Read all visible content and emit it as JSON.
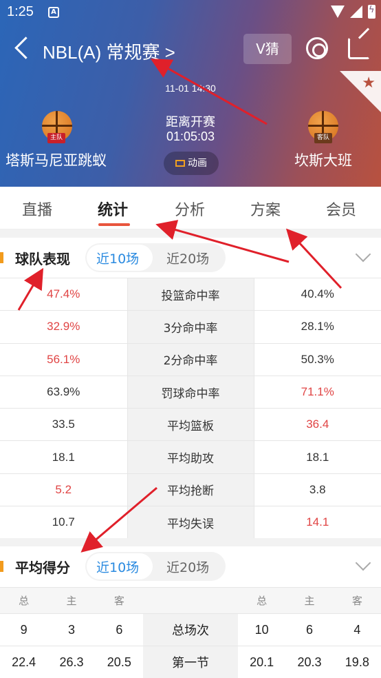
{
  "status": {
    "time": "1:25",
    "a_icon": "A"
  },
  "header": {
    "league": "NBL(A) 常规赛 >",
    "vguess": "V猜",
    "match_time": "11-01 14:30",
    "countdown_label": "距离开赛",
    "countdown": "01:05:03",
    "animation_label": "动画",
    "home": {
      "name": "塔斯马尼亚跳蚁",
      "badge": "主队",
      "badge_color": "#c8202a"
    },
    "away": {
      "name": "坎斯大班",
      "badge": "客队",
      "badge_color": "#6b3a1c"
    }
  },
  "tabs": [
    "直播",
    "统计",
    "分析",
    "方案",
    "会员"
  ],
  "team_perf": {
    "title": "球队表现",
    "opt1": "近10场",
    "opt2": "近20场",
    "rows": [
      {
        "home": "47.4%",
        "label": "投篮命中率",
        "away": "40.4%",
        "hi": "home"
      },
      {
        "home": "32.9%",
        "label": "3分命中率",
        "away": "28.1%",
        "hi": "home"
      },
      {
        "home": "56.1%",
        "label": "2分命中率",
        "away": "50.3%",
        "hi": "home"
      },
      {
        "home": "63.9%",
        "label": "罚球命中率",
        "away": "71.1%",
        "hi": "away"
      },
      {
        "home": "33.5",
        "label": "平均篮板",
        "away": "36.4",
        "hi": "away"
      },
      {
        "home": "18.1",
        "label": "平均助攻",
        "away": "18.1",
        "hi": "none"
      },
      {
        "home": "5.2",
        "label": "平均抢断",
        "away": "3.8",
        "hi": "home"
      },
      {
        "home": "10.7",
        "label": "平均失误",
        "away": "14.1",
        "hi": "away"
      }
    ]
  },
  "avg_score": {
    "title": "平均得分",
    "opt1": "近10场",
    "opt2": "近20场",
    "headers": [
      "总",
      "主",
      "客",
      "总",
      "主",
      "客"
    ],
    "rows": [
      {
        "label": "总场次",
        "left": [
          "9",
          "3",
          "6"
        ],
        "right": [
          "10",
          "6",
          "4"
        ],
        "red_left": -1
      },
      {
        "label": "第一节",
        "left": [
          "22.4",
          "26.3",
          "20.5"
        ],
        "right": [
          "20.1",
          "20.3",
          "19.8"
        ],
        "red_left": 1
      }
    ]
  },
  "colors": {
    "accent_red": "#e04444",
    "accent_blue": "#2a8ae0",
    "tab_underline": "#e8553d",
    "arrow": "#e0202a"
  }
}
